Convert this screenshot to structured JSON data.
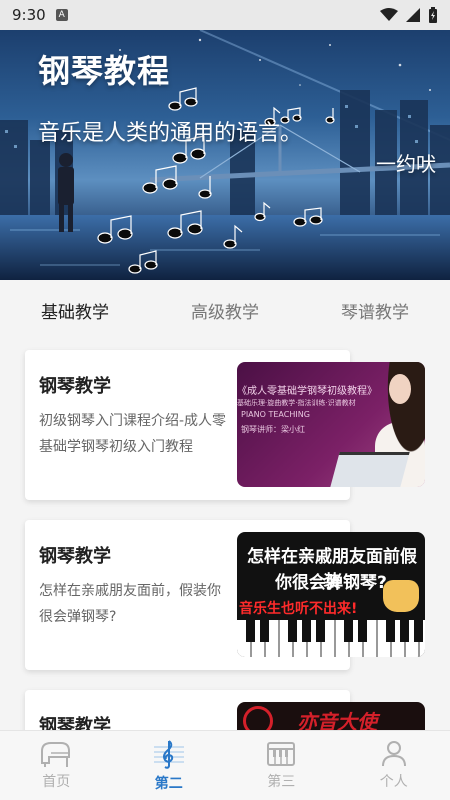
{
  "status_bar": {
    "time": "9:30",
    "notification_badge": "A"
  },
  "banner": {
    "title": "钢琴教程",
    "quote": "音乐是人类的通用的语言。",
    "signature": "一约吠"
  },
  "tabs": [
    {
      "label": "基础教学",
      "active": true
    },
    {
      "label": "高级教学",
      "active": false
    },
    {
      "label": "琴谱教学",
      "active": false
    }
  ],
  "cards": [
    {
      "title": "钢琴教学",
      "description": "初级钢琴入门课程介绍-成人零基础学钢琴初级入门教程",
      "thumbnail_lines": [
        "《成人零基础学钢琴初级教程》",
        "基础乐理·旋曲教学·指法训练·识谱教材",
        "PIANO TEACHING",
        "钢琴讲师：梁小红"
      ]
    },
    {
      "title": "钢琴教学",
      "description": "怎样在亲戚朋友面前，假装你很会弹钢琴?",
      "thumbnail_lines": [
        "怎样在亲戚朋友面前假装",
        "你很会弹钢琴?",
        "音乐生也听不出来!"
      ]
    },
    {
      "title": "钢琴教学",
      "description": "",
      "thumbnail_lines": [
        "亦音大使"
      ]
    }
  ],
  "bottom_nav": [
    {
      "label": "首页",
      "icon": "piano-icon",
      "active": false
    },
    {
      "label": "第二",
      "icon": "treble-clef-icon",
      "active": true
    },
    {
      "label": "第三",
      "icon": "keyboard-icon",
      "active": false
    },
    {
      "label": "个人",
      "icon": "person-icon",
      "active": false
    }
  ],
  "colors": {
    "accent": "#2a78c8",
    "inactive": "#b0b0b0"
  }
}
